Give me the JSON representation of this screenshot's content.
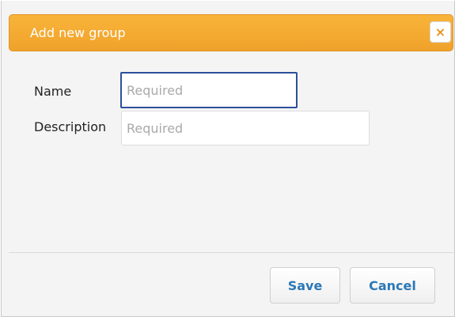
{
  "dialog": {
    "title": "Add new group",
    "close_label": "×"
  },
  "form": {
    "name_label": "Name",
    "name_placeholder": "Required",
    "description_label": "Description",
    "description_placeholder": "Required"
  },
  "buttons": {
    "save_label": "Save",
    "cancel_label": "Cancel"
  },
  "colors": {
    "titlebar": "#f5aa33",
    "close_icon": "#e8931f",
    "button_text": "#2b78b7",
    "focus_border": "#2d4f9c"
  },
  "icons": {
    "close": "close-icon"
  }
}
